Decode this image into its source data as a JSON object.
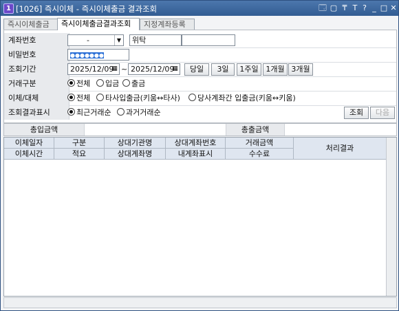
{
  "window": {
    "badge": "1",
    "title": "[1026]  즉시이체 - 즉시이체출금 결과조회",
    "controls": [
      "🗔",
      "▢",
      "₸",
      "T",
      "?",
      "_",
      "□",
      "✕"
    ]
  },
  "tabs": [
    {
      "label": "즉시이체출금"
    },
    {
      "label": "즉시이체출금결과조회"
    },
    {
      "label": "지정계좌등록"
    }
  ],
  "form": {
    "account": {
      "label": "계좌번호",
      "value": "-",
      "owner": "위탁"
    },
    "password": {
      "label": "비밀번호",
      "value": "●●●●●●●"
    },
    "period": {
      "label": "조회기간",
      "from": "2025/12/09",
      "sep": "~",
      "to": "2025/12/09",
      "buttons": [
        "당일",
        "3일",
        "1주일",
        "1개월",
        "3개월"
      ]
    },
    "tx_type": {
      "label": "거래구분",
      "options": [
        "전체",
        "입금",
        "출금"
      ],
      "selected": 0
    },
    "transfer": {
      "label": "이체/대체",
      "options": [
        "전체",
        "타사입출금(키움↔타사)",
        "당사계좌간 입출금(키움↔키움)"
      ],
      "selected": 0
    },
    "display": {
      "label": "조회결과표시",
      "options": [
        "최근거래순",
        "과거거래순"
      ],
      "selected": 0
    },
    "search_button": "조회",
    "next_button": "다음"
  },
  "summary": {
    "deposit_total": "총입금액",
    "withdraw_total": "총출금액"
  },
  "grid": {
    "header_top": [
      "이체일자",
      "구분",
      "상대기관명",
      "상대계좌번호",
      "거래금액"
    ],
    "header_bottom": [
      "이체시간",
      "적요",
      "상대계좌명",
      "내계좌표시",
      "수수료"
    ],
    "header_result": "처리결과"
  }
}
